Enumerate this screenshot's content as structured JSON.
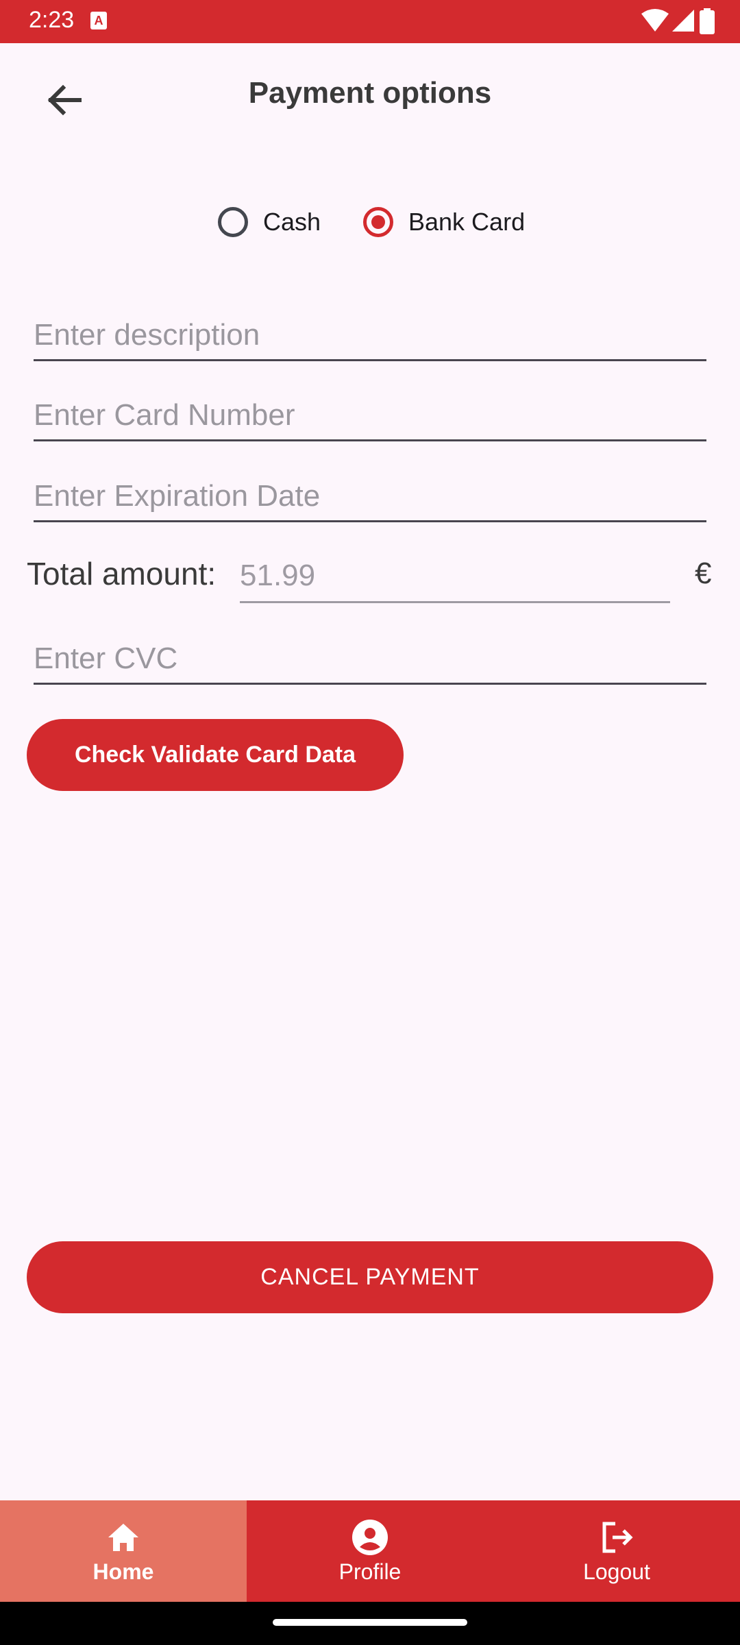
{
  "status_bar": {
    "time": "2:23",
    "notification_icon": "accessibility-notification-icon",
    "notification_letter": "A",
    "icons": [
      "wifi-icon",
      "signal-icon",
      "battery-icon"
    ]
  },
  "header": {
    "title": "Payment options",
    "back_icon": "arrow-back-icon"
  },
  "payment_method": {
    "options": [
      {
        "label": "Cash",
        "selected": false
      },
      {
        "label": "Bank Card",
        "selected": true
      }
    ]
  },
  "form": {
    "description_placeholder": "Enter description",
    "card_number_placeholder": "Enter Card Number",
    "expiration_placeholder": "Enter Expiration Date",
    "total_label": "Total amount:",
    "total_value": "51.99",
    "currency": "€",
    "cvc_placeholder": "Enter CVC",
    "validate_button": "Check Validate Card Data"
  },
  "actions": {
    "cancel_button": "CANCEL PAYMENT"
  },
  "bottom_nav": {
    "items": [
      {
        "label": "Home",
        "icon": "home-icon",
        "active": true
      },
      {
        "label": "Profile",
        "icon": "account-circle-icon",
        "active": false
      },
      {
        "label": "Logout",
        "icon": "logout-icon",
        "active": false
      }
    ]
  },
  "colors": {
    "primary": "#d32a2e",
    "nav_active": "#e57362",
    "background": "#fdf6fc"
  }
}
